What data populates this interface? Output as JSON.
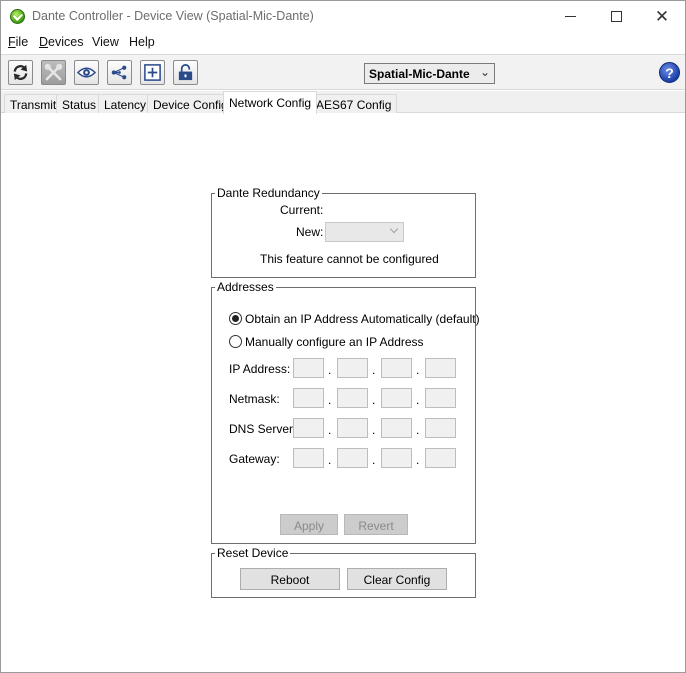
{
  "window": {
    "title": "Dante Controller - Device View (Spatial-Mic-Dante)",
    "controls": {
      "minimize": "minimize",
      "maximize": "maximize",
      "close": "✕"
    }
  },
  "menu": {
    "file": {
      "ul": "F",
      "rest": "ile"
    },
    "devices": {
      "ul": "D",
      "rest": "evices"
    },
    "view": "View",
    "help": "Help"
  },
  "toolbar": {
    "icons": [
      "refresh-icon",
      "tools-icon",
      "eye-icon",
      "network-icon",
      "add-icon",
      "unlock-icon"
    ],
    "device_selected": "Spatial-Mic-Dante",
    "help_glyph": "?"
  },
  "tabs": [
    {
      "label": "Transmit"
    },
    {
      "label": "Status"
    },
    {
      "label": "Latency"
    },
    {
      "label": "Device Config"
    },
    {
      "label": "Network Config",
      "active": true
    },
    {
      "label": "AES67 Config"
    }
  ],
  "redundancy": {
    "title": "Dante Redundancy",
    "current_label": "Current:",
    "current_value": "",
    "new_label": "New:",
    "new_value": "",
    "note": "This feature cannot be configured"
  },
  "addresses": {
    "title": "Addresses",
    "option_auto": "Obtain an IP Address Automatically (default)",
    "option_manual": "Manually configure an IP Address",
    "selected": "auto",
    "fields": [
      {
        "label": "IP Address:",
        "octets": [
          "",
          "",
          "",
          ""
        ]
      },
      {
        "label": "Netmask:",
        "octets": [
          "",
          "",
          "",
          ""
        ]
      },
      {
        "label": "DNS Server:",
        "octets": [
          "",
          "",
          "",
          ""
        ]
      },
      {
        "label": "Gateway:",
        "octets": [
          "",
          "",
          "",
          ""
        ]
      }
    ],
    "separator": ".",
    "apply_label": "Apply",
    "revert_label": "Revert"
  },
  "reset": {
    "title": "Reset Device",
    "reboot_label": "Reboot",
    "clear_label": "Clear Config"
  }
}
